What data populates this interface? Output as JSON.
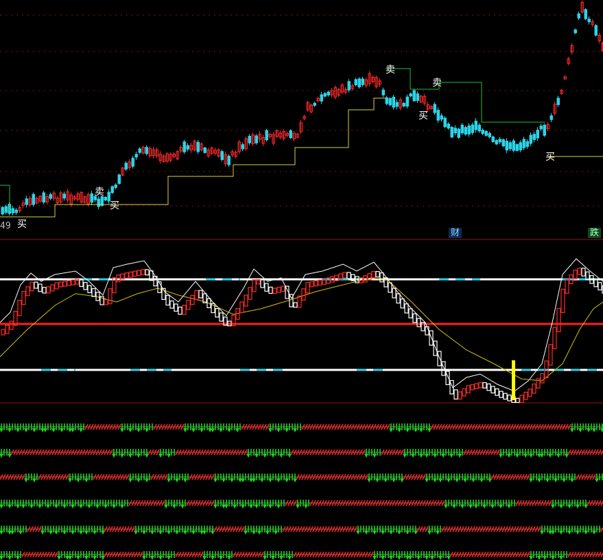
{
  "badges": {
    "cai": "财",
    "die": "跌"
  },
  "price_label": "49",
  "signal_labels": {
    "buy": "买",
    "sell": "卖"
  },
  "colors": {
    "up": "#ff2a2a",
    "down": "#2ad4e8",
    "stop_line": "#e0d23a",
    "stop_green": "#22c030",
    "osc_white": "#ffffff",
    "osc_yellow": "#d8c000",
    "mid_red": "#ff1e1e",
    "band_cyan": "#2ad4e8",
    "arrow_green": "#1fd21f",
    "arrow_red": "#ff2020",
    "marker": "#ffff00",
    "grid": "#8a1010"
  },
  "chart_data": {
    "type": "candlestick-indicator",
    "panels": [
      "price",
      "oscillator",
      "signal-strips"
    ],
    "price_signals": [
      {
        "label": "买",
        "kind": "buy"
      },
      {
        "label": "卖",
        "kind": "sell"
      },
      {
        "label": "买",
        "kind": "buy"
      },
      {
        "label": "卖",
        "kind": "sell"
      },
      {
        "label": "卖",
        "kind": "sell"
      },
      {
        "label": "买",
        "kind": "buy"
      },
      {
        "label": "买",
        "kind": "buy"
      }
    ],
    "oscillator_levels": [
      "upper",
      "middle",
      "lower"
    ],
    "signal_strip_rows": 6,
    "grid": true
  }
}
